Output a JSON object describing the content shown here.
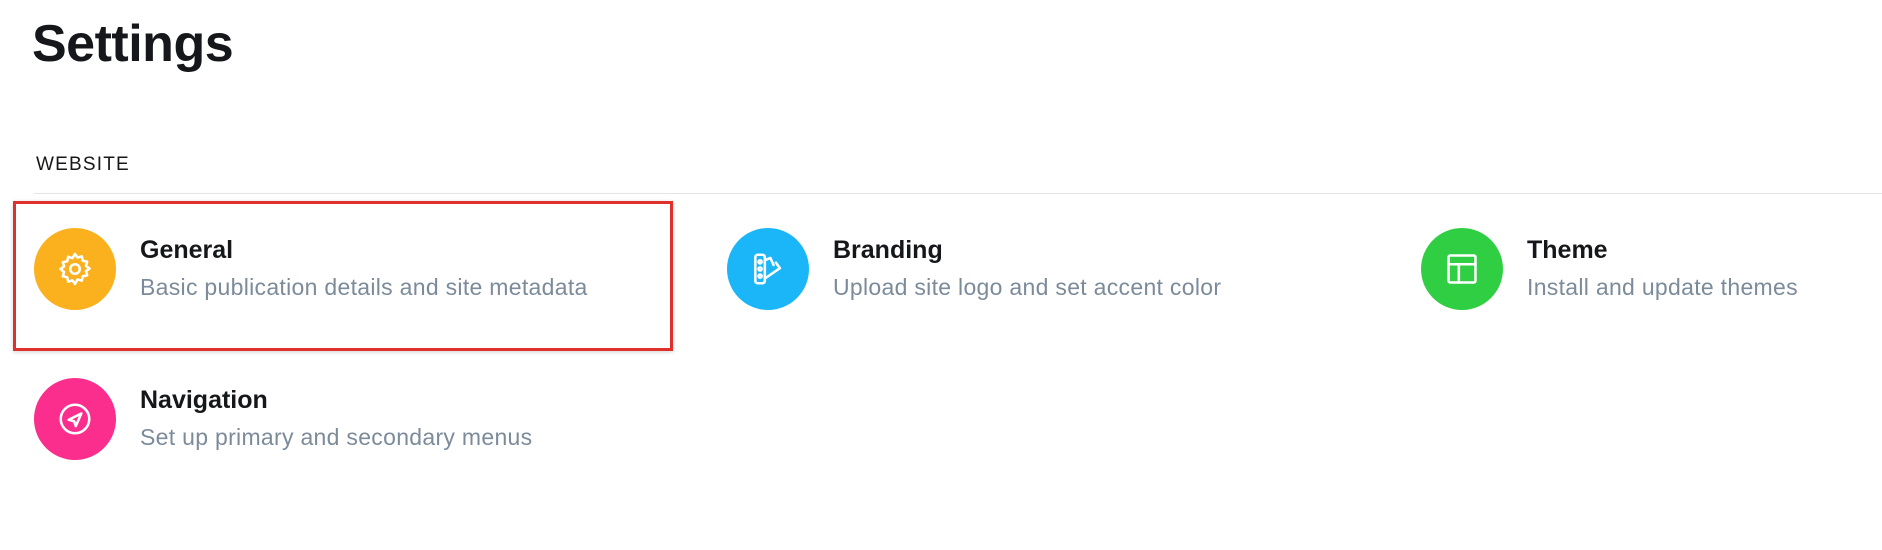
{
  "page": {
    "title": "Settings"
  },
  "section": {
    "title": "WEBSITE"
  },
  "items": [
    {
      "title": "General",
      "description": "Basic publication details and site metadata",
      "icon": "gear-icon",
      "color": "#fbb11d",
      "highlighted": true
    },
    {
      "title": "Branding",
      "description": "Upload site logo and set accent color",
      "icon": "palette-icon",
      "color": "#1ab6f7"
    },
    {
      "title": "Theme",
      "description": "Install and update themes",
      "icon": "layout-icon",
      "color": "#30cf43"
    },
    {
      "title": "Navigation",
      "description": "Set up primary and secondary menus",
      "icon": "navigation-icon",
      "color": "#fb2d8d"
    }
  ],
  "colors": {
    "highlight_border": "#e0302b",
    "divider": "#e3e6e9",
    "description_text": "#7c8b9a"
  }
}
